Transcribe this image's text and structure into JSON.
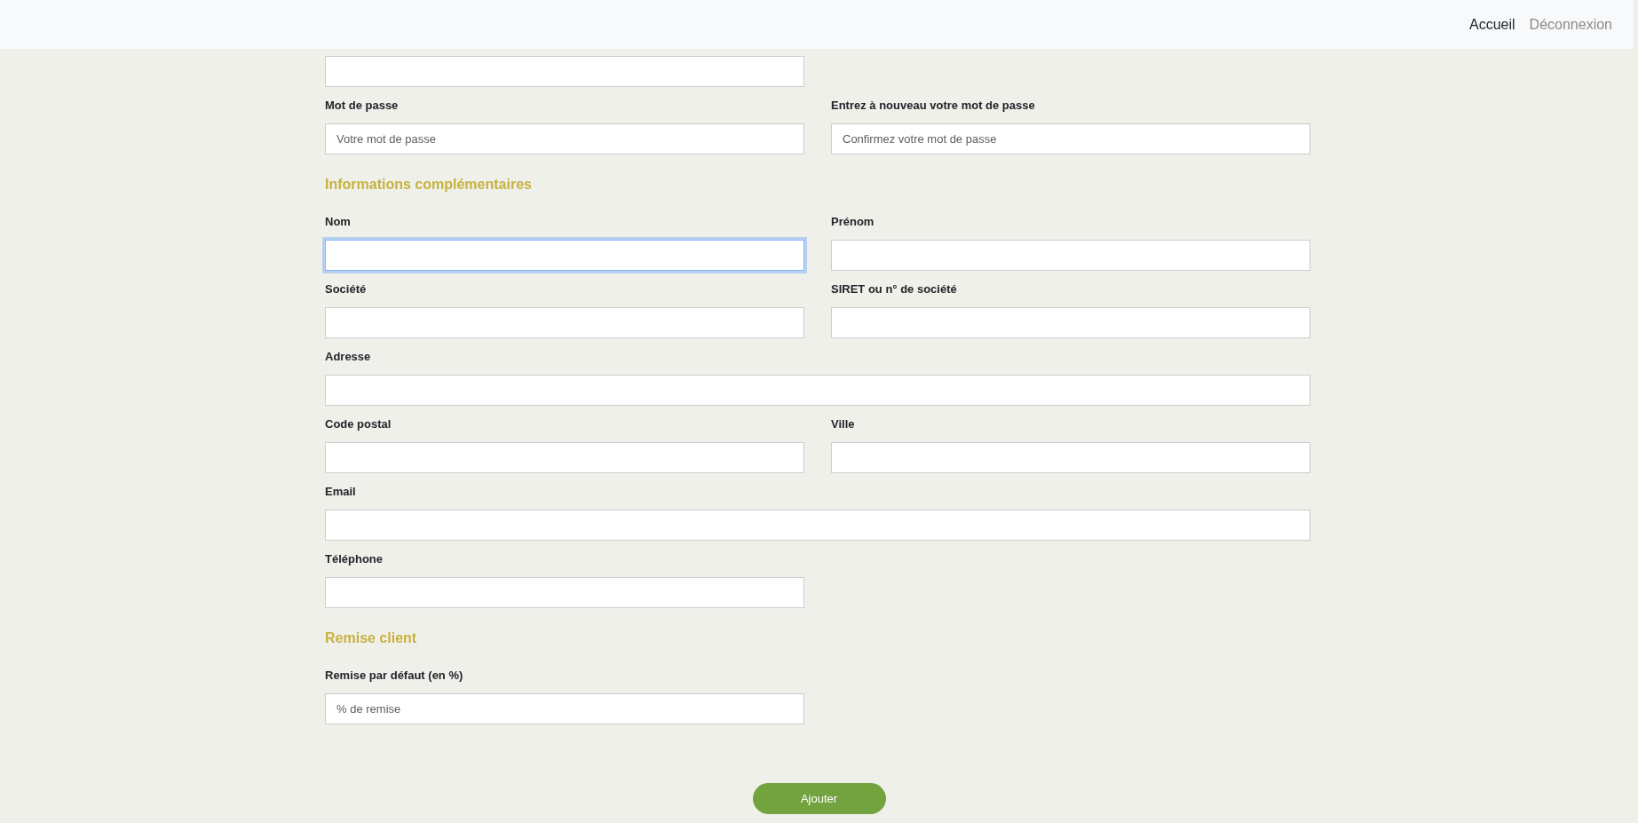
{
  "nav": {
    "links": [
      {
        "label": "Accueil",
        "selected": true
      },
      {
        "label": "Déconnexion",
        "selected": false
      }
    ]
  },
  "sections": [
    {
      "rows": [
        [
          {
            "kind": "text",
            "focused": false
          }
        ]
      ]
    },
    {
      "rows": [
        [
          {
            "kind": "password",
            "label": "Mot de passe",
            "placeholder": "Votre mot de passe",
            "focused": false
          },
          {
            "kind": "password",
            "label": "Entrez à nouveau votre mot de passe",
            "placeholder": "Confirmez votre mot de passe",
            "focused": false
          }
        ]
      ]
    },
    {
      "title": "Informations complémentaires",
      "rows": [
        [
          {
            "kind": "text",
            "label": "Nom",
            "focused": true
          },
          {
            "kind": "text",
            "label": "Prénom",
            "focused": false
          }
        ],
        [
          {
            "kind": "text",
            "label": "Société",
            "focused": false
          },
          {
            "kind": "text",
            "label": "SIRET ou n° de société",
            "focused": false
          }
        ],
        [
          {
            "kind": "wide",
            "label": "Adresse",
            "focused": false
          }
        ],
        [
          {
            "kind": "text",
            "label": "Code postal",
            "focused": false
          },
          {
            "kind": "text",
            "label": "Ville",
            "focused": false
          }
        ],
        [
          {
            "kind": "wide",
            "label": "Email",
            "focused": false
          }
        ],
        [
          {
            "kind": "text",
            "label": "Téléphone",
            "focused": false
          }
        ]
      ]
    },
    {
      "title": "Remise client",
      "rows": [
        [
          {
            "kind": "number",
            "label": "Remise par défaut (en %)",
            "placeholder": "% de remise",
            "focused": false
          }
        ]
      ]
    }
  ],
  "submit": {
    "label": "Ajouter"
  }
}
